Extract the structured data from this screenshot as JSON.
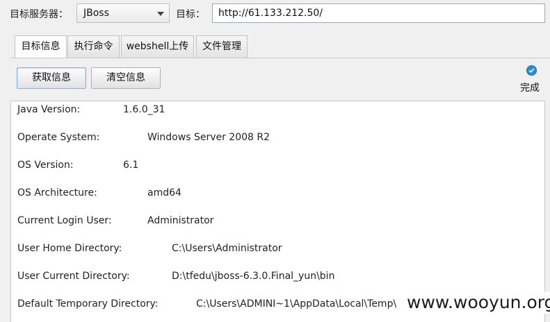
{
  "toolbar": {
    "server_label": "目标服务器：",
    "server_selected": "JBoss",
    "target_label": "目标：",
    "target_url": "http://61.133.212.50/"
  },
  "tabs": [
    {
      "label": "目标信息",
      "active": true
    },
    {
      "label": "执行命令",
      "active": false
    },
    {
      "label": "webshell上传",
      "active": false
    },
    {
      "label": "文件管理",
      "active": false
    }
  ],
  "actions": {
    "get_info": "获取信息",
    "clear_info": "清空信息"
  },
  "status": {
    "text": "完成",
    "icon": "check-circle-icon",
    "color": "#2a8ad6"
  },
  "info": [
    {
      "key": "Java Version:",
      "value": "1.6.0_31"
    },
    {
      "key": "Operate System:",
      "value": "Windows Server 2008 R2"
    },
    {
      "key": "OS Version:",
      "value": "6.1"
    },
    {
      "key": "OS Architecture:",
      "value": "amd64"
    },
    {
      "key": "Current Login User:",
      "value": "Administrator"
    },
    {
      "key": "User Home Directory:",
      "value": "C:\\Users\\Administrator"
    },
    {
      "key": "User Current Directory:",
      "value": "D:\\tfedu\\jboss-6.3.0.Final_yun\\bin"
    },
    {
      "key": "Default Temporary Directory:",
      "value": "C:\\Users\\ADMINI~1\\AppData\\Local\\Temp\\"
    }
  ],
  "watermark": "www.wooyun.org"
}
